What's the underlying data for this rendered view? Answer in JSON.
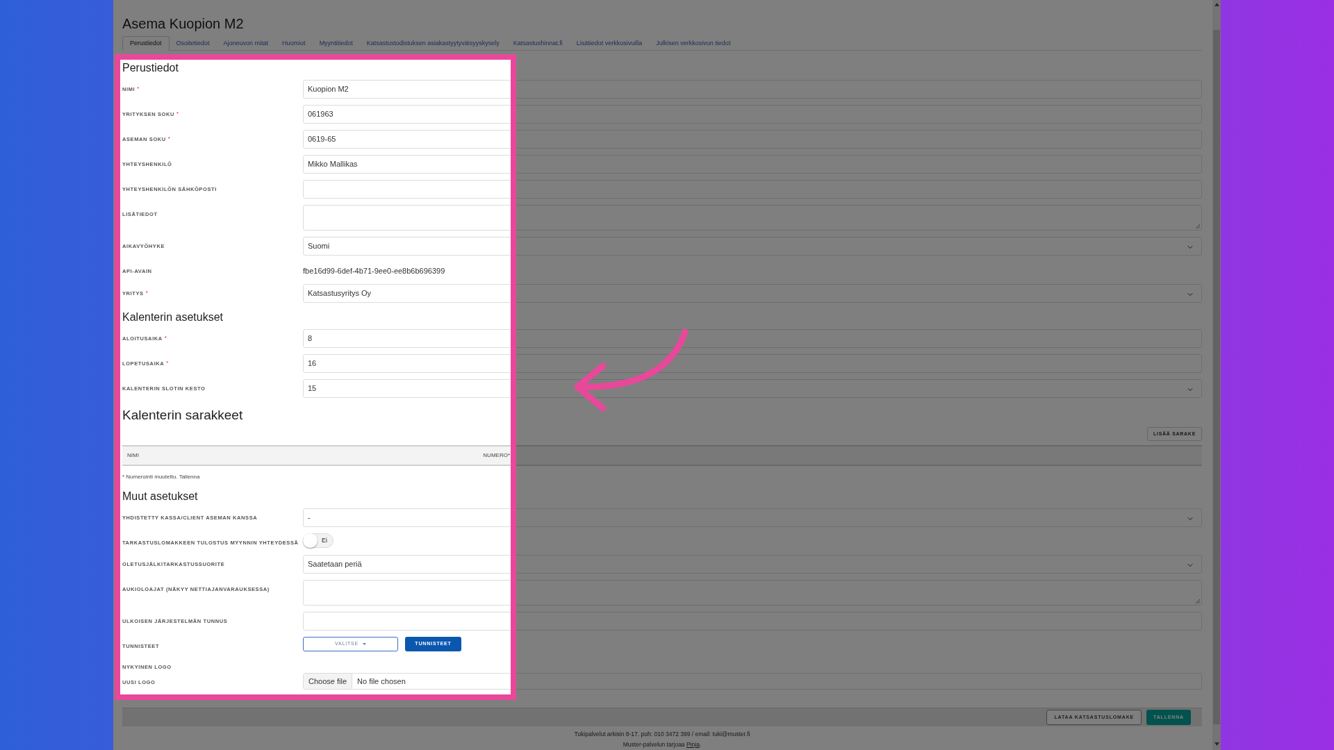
{
  "page_title": "Asema Kuopion M2",
  "tabs": [
    {
      "label": "Perustiedot",
      "selected": true
    },
    {
      "label": "Osoitetiedot",
      "selected": false
    },
    {
      "label": "Ajoneuvon mitat",
      "selected": false
    },
    {
      "label": "Huomiot",
      "selected": false
    },
    {
      "label": "Myyntitiedot",
      "selected": false
    },
    {
      "label": "Katsastustodistuksen asiakastyytyväisyyskysely",
      "selected": false
    },
    {
      "label": "Katsastushinnat.fi",
      "selected": false
    },
    {
      "label": "Lisätiedot verkkosivuilla",
      "selected": false
    },
    {
      "label": "Julkisen verkkosivun tiedot",
      "selected": false
    }
  ],
  "sections": [
    {
      "kind": "fields",
      "heading": "Perustiedot",
      "fields": [
        {
          "kind": "input",
          "label": "NIMI",
          "required_mark": "*",
          "value": "Kuopion M2"
        },
        {
          "kind": "input",
          "label": "YRITYKSEN SOKU",
          "required_mark": "*",
          "value": "061963"
        },
        {
          "kind": "input",
          "label": "ASEMAN SOKU",
          "required_mark": "*",
          "value": "0619-65"
        },
        {
          "kind": "input",
          "label": "YHTEYSHENKILÖ",
          "value": "Mikko Mallikas"
        },
        {
          "kind": "input",
          "label": "YHTEYSHENKILÖN SÄHKÖPOSTI"
        },
        {
          "kind": "textarea",
          "label": "LISÄTIEDOT"
        },
        {
          "kind": "select",
          "label": "AIKAVYÖHYKE",
          "value": "Suomi"
        },
        {
          "kind": "text",
          "label": "API-AVAIN",
          "value": "fbe16d99-6def-4b71-9ee0-ee8b6b696399"
        },
        {
          "kind": "select",
          "label": "YRITYS",
          "required_mark": "*",
          "value": "Katsastusyritys Oy"
        }
      ]
    },
    {
      "kind": "fields",
      "heading": "Kalenterin asetukset",
      "fields": [
        {
          "kind": "input",
          "label": "ALOITUSAIKA",
          "required_mark": "*",
          "value": "8"
        },
        {
          "kind": "input",
          "label": "LOPETUSAIKA",
          "required_mark": "*",
          "value": "16"
        },
        {
          "kind": "select",
          "label": "KALENTERIN SLOTIN KESTO",
          "value": "15"
        }
      ]
    },
    {
      "kind": "table",
      "heading": "Kalenterin sarakkeet",
      "add_button": "LISÄÄ SARAKE",
      "columns": [
        "NIMI",
        "NUMERO*"
      ],
      "note": "* Numerointi muutettu. Tallenna"
    },
    {
      "kind": "fields",
      "heading": "Muut asetukset",
      "fields": [
        {
          "kind": "select",
          "label": "YHDISTETTY KASSA/CLIENT ASEMAN KANSSA",
          "value": "-"
        },
        {
          "kind": "toggle",
          "label": "TARKASTUSLOMAKKEEN TULOSTUS MYYNNIN YHTEYDESSÄ",
          "on": false,
          "value": "Ei"
        },
        {
          "kind": "select",
          "label": "OLETUSJÄLKITARKASTUSSUORITE",
          "value": "Saatetaan periä"
        },
        {
          "kind": "textarea",
          "label": "AUKIOLOAJAT (NÄKYY NETTIAJANVARAUKSESSA)"
        },
        {
          "kind": "input",
          "label": "ULKOISEN JÄRJESTELMÄN TUNNUS"
        },
        {
          "kind": "buttons",
          "label": "TUNNISTEET",
          "buttons": [
            {
              "kind": "dropdown",
              "label": "VALITSE"
            },
            {
              "kind": "primary",
              "label": "TUNNISTEET"
            }
          ]
        },
        {
          "kind": "none",
          "label": "NYKYINEN LOGO"
        },
        {
          "kind": "file",
          "label": "UUSI LOGO",
          "button": "Choose file",
          "value": "No file chosen"
        }
      ]
    }
  ],
  "actions": [
    {
      "kind": "outline",
      "label": "LATAA KATSASTUSLOMAKE"
    },
    {
      "kind": "primary",
      "label": "TALLENNA"
    }
  ],
  "footer": {
    "line1": "Tukipalvelut arkisin 8-17. puh: 010 3472 399 / email: tuki@muster.fi",
    "line2_prefix": "Muster-palvelun tarjoaa ",
    "line2_link": "Pinja",
    "line2_suffix": "."
  }
}
